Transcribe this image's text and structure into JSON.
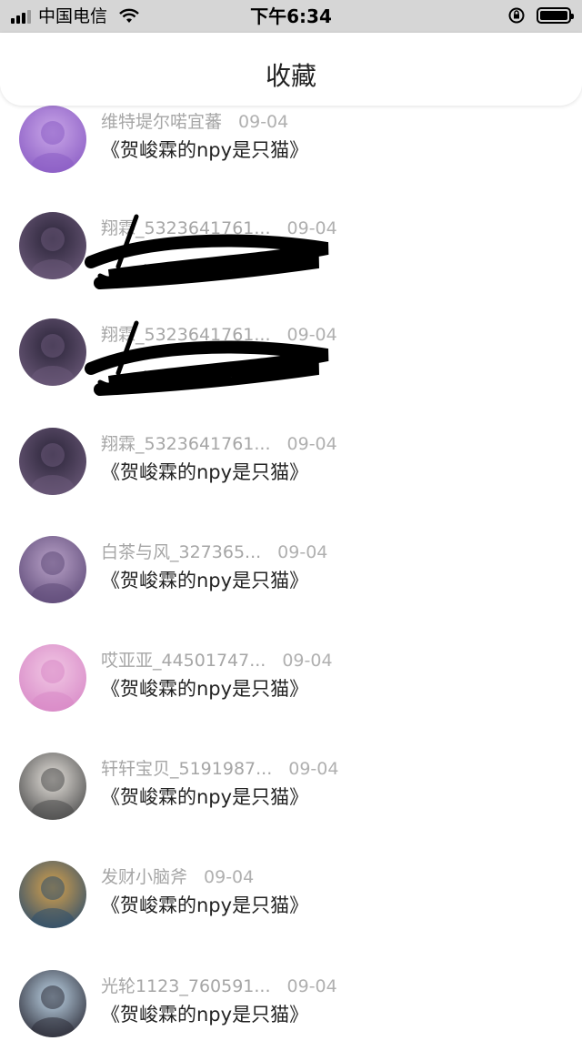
{
  "status_bar": {
    "carrier": "中国电信",
    "time": "下午6:34"
  },
  "header": {
    "title": "收藏"
  },
  "items": [
    {
      "user": "维特堤尔喏宜蕃",
      "date": "09-04",
      "post": "《贺峻霖的npy是只猫》",
      "avatar_icon": "flower-avatar-icon",
      "colors": [
        "#c9a6e8",
        "#8a5cc4"
      ]
    },
    {
      "user": "翔霖_5323641761...",
      "date": "09-04",
      "post": "",
      "avatar_icon": "boy-dark-avatar-icon",
      "colors": [
        "#2a2438",
        "#6c5a7a"
      ],
      "redacted": true
    },
    {
      "user": "翔霖_5323641761...",
      "date": "09-04",
      "post": "",
      "avatar_icon": "boy-dark-avatar-icon",
      "colors": [
        "#2a2438",
        "#6c5a7a"
      ],
      "redacted": true
    },
    {
      "user": "翔霖_5323641761...",
      "date": "09-04",
      "post": "《贺峻霖的npy是只猫》",
      "avatar_icon": "boy-dark-avatar-icon",
      "colors": [
        "#2a2438",
        "#6c5a7a"
      ]
    },
    {
      "user": "白茶与风_327365...",
      "date": "09-04",
      "post": "《贺峻霖的npy是只猫》",
      "avatar_icon": "figure-purple-avatar-icon",
      "colors": [
        "#b9a2c8",
        "#5e4a78"
      ]
    },
    {
      "user": "哎亚亚_44501747...",
      "date": "09-04",
      "post": "《贺峻霖的npy是只猫》",
      "avatar_icon": "boy-pink-avatar-icon",
      "colors": [
        "#f1c7e4",
        "#d889c7"
      ]
    },
    {
      "user": "轩轩宝贝_5191987...",
      "date": "09-04",
      "post": "《贺峻霖的npy是只猫》",
      "avatar_icon": "boy-standing-avatar-icon",
      "colors": [
        "#e7e3dd",
        "#4a4a4a"
      ]
    },
    {
      "user": "发财小脑斧",
      "date": "09-04",
      "post": "《贺峻霖的npy是只猫》",
      "avatar_icon": "cartoon-monster-avatar-icon",
      "colors": [
        "#d7a24c",
        "#2e4e6c"
      ]
    },
    {
      "user": "光轮1123_760591...",
      "date": "09-04",
      "post": "《贺峻霖的npy是只猫》",
      "avatar_icon": "boy-portrait-avatar-icon",
      "colors": [
        "#bfd6e8",
        "#2b2b36"
      ]
    }
  ]
}
